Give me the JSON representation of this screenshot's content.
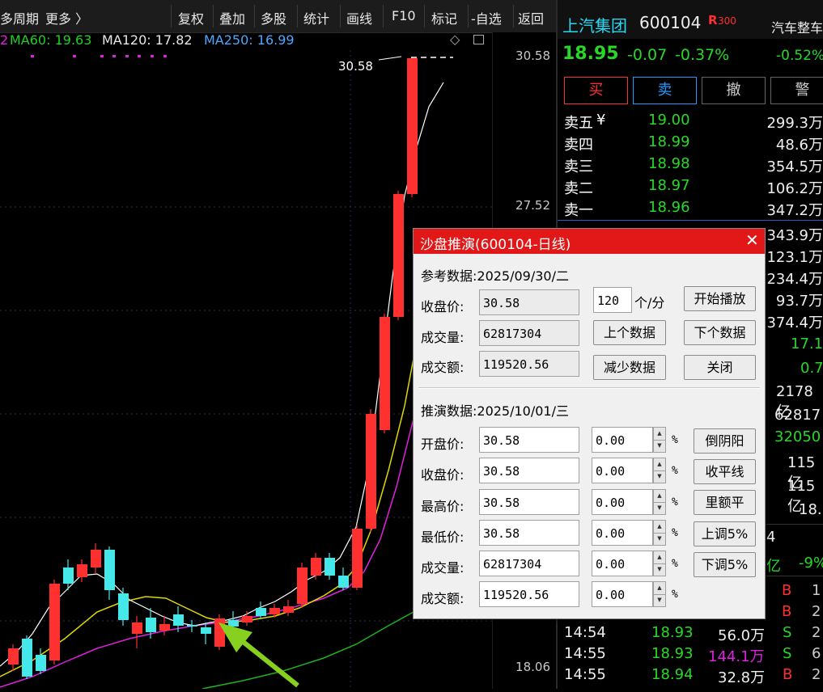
{
  "toolbar": {
    "period": "多周期",
    "more": "更多 〉",
    "items": [
      "复权",
      "叠加",
      "多股",
      "统计",
      "画线",
      "F10",
      "标记",
      "-自选",
      "返回"
    ]
  },
  "ma": {
    "ma60": "MA60: 19.63",
    "ma120": "MA120: 17.82",
    "ma250": "MA250: 16.99"
  },
  "price_axis": {
    "labels": [
      "30.58",
      "27.52",
      "18.06"
    ],
    "peak_label": "30.58"
  },
  "stock": {
    "name": "上汽集团",
    "code": "600104",
    "badge": "R",
    "badge_num": "300",
    "price": "18.95",
    "change": "-0.07",
    "change_pct": "-0.37%",
    "sector": "汽车整车",
    "sector_pct": "-0.52%"
  },
  "trade_buttons": [
    "买",
    "卖",
    "撤",
    "警"
  ],
  "order_book": {
    "sell": [
      {
        "label": "卖五",
        "price": "19.00",
        "vol": "299.3万"
      },
      {
        "label": "卖四",
        "price": "18.99",
        "vol": "48.6万"
      },
      {
        "label": "卖三",
        "price": "18.98",
        "vol": "354.5万"
      },
      {
        "label": "卖二",
        "price": "18.97",
        "vol": "106.2万"
      },
      {
        "label": "卖一",
        "price": "18.96",
        "vol": "347.2万"
      }
    ],
    "buy_vols": [
      "343.9万",
      "123.1万",
      "234.4万",
      "93.7万",
      "374.4万"
    ]
  },
  "stats": [
    "17.1",
    "0.7",
    "2178亿",
    "62817",
    "32050",
    "115亿",
    "115亿",
    "18."
  ],
  "side_partial": [
    "4",
    "亿",
    "-9%"
  ],
  "ticks": [
    {
      "time": "14:54",
      "price": "18.93",
      "vol": "56.0万",
      "bs": "S",
      "n": "2"
    },
    {
      "time": "14:55",
      "price": "18.93",
      "vol": "144.1万",
      "bs": "S",
      "n": "6"
    },
    {
      "time": "14:55",
      "price": "18.94",
      "vol": "32.8万",
      "bs": "B",
      "n": "2"
    }
  ],
  "tick_partial": [
    {
      "bs": "B",
      "n": "1"
    },
    {
      "bs": "B",
      "n": "2"
    }
  ],
  "dialog": {
    "title": "沙盘推演(600104-日线)",
    "ref_label": "参考数据:2025/09/30/二",
    "close_label": "收盘价:",
    "close_val": "30.58",
    "vol_label": "成交量:",
    "vol_val": "62817304",
    "amt_label": "成交额:",
    "amt_val": "119520.56",
    "speed_val": "120",
    "speed_unit": "个/分",
    "btn_play": "开始播放",
    "btn_prev": "上个数据",
    "btn_next": "下个数据",
    "btn_reduce": "减少数据",
    "btn_close": "关闭",
    "sim_label": "推演数据:2025/10/01/三",
    "rows": [
      {
        "label": "开盘价:",
        "val": "30.58",
        "pct": "0.00"
      },
      {
        "label": "收盘价:",
        "val": "30.58",
        "pct": "0.00"
      },
      {
        "label": "最高价:",
        "val": "30.58",
        "pct": "0.00"
      },
      {
        "label": "最低价:",
        "val": "30.58",
        "pct": "0.00"
      },
      {
        "label": "成交量:",
        "val": "62817304",
        "pct": "0.00"
      },
      {
        "label": "成交额:",
        "val": "119520.56",
        "pct": "0.00"
      }
    ],
    "pct_sign": "%",
    "side_buttons": [
      "倒阴阳",
      "收平线",
      "里额平",
      "上调5%",
      "下调5%"
    ]
  },
  "colors": {
    "up": "#ff3030",
    "down": "#44e8e8",
    "ma_white": "#ffffff",
    "ma_yellow": "#e8e000",
    "ma_magenta": "#e020e0",
    "ma_green": "#20c020",
    "accent_red": "#e21818"
  }
}
